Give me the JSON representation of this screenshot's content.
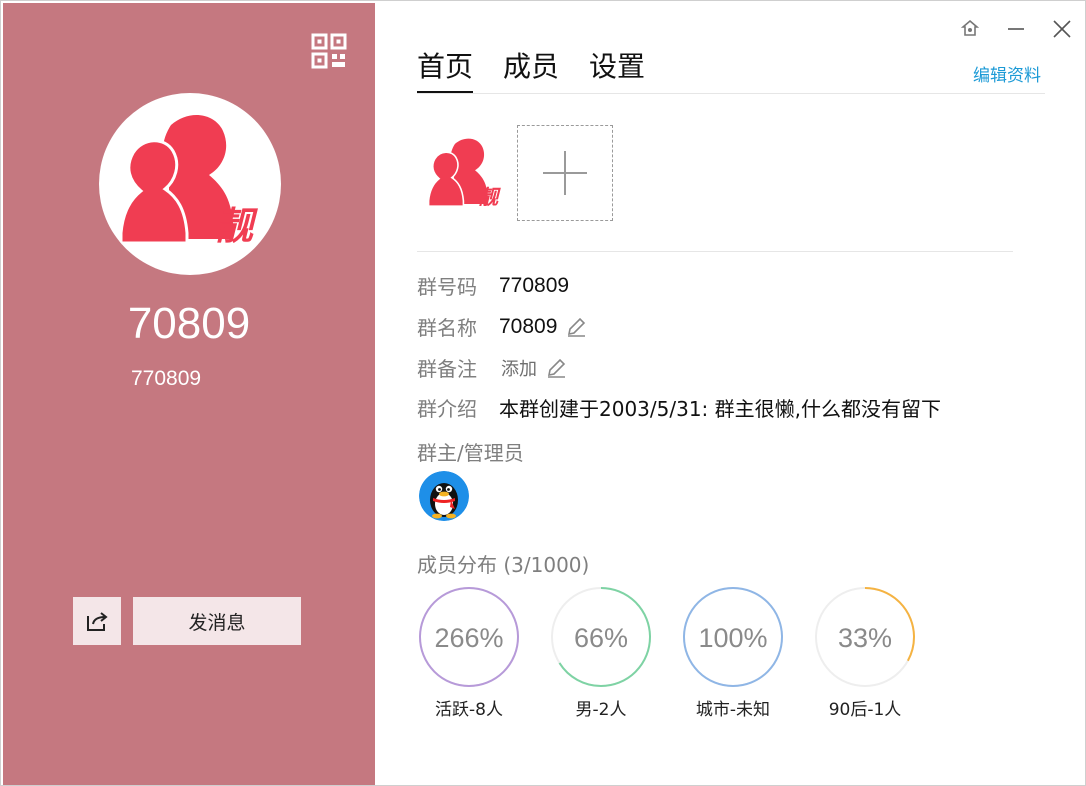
{
  "colors": {
    "left_panel_bg": "#c57880",
    "brand_red": "#f03d52",
    "link": "#1c9ad6"
  },
  "profile": {
    "name": "70809",
    "id": "770809",
    "avatar_text": "靓",
    "send_message": "发消息"
  },
  "tabs": [
    {
      "label": "首页",
      "active": true
    },
    {
      "label": "成员",
      "active": false
    },
    {
      "label": "设置",
      "active": false
    }
  ],
  "edit_profile": "编辑资料",
  "info": {
    "number_label": "群号码",
    "number_value": "770809",
    "name_label": "群名称",
    "name_value": "70809",
    "note_label": "群备注",
    "note_value": "添加",
    "intro_label": "群介绍",
    "intro_value": "本群创建于2003/5/31:  群主很懒,什么都没有留下"
  },
  "admins_title": "群主/管理员",
  "distribution": {
    "title": "成员分布 (3/1000)",
    "items": [
      {
        "percent_text": "266%",
        "label": "活跃-8人",
        "color": "#b79ad9",
        "fraction": 1.0
      },
      {
        "percent_text": "66%",
        "label": "男-2人",
        "color": "#7ed3a4",
        "fraction": 0.66
      },
      {
        "percent_text": "100%",
        "label": "城市-未知",
        "color": "#8fb6e6",
        "fraction": 1.0
      },
      {
        "percent_text": "33%",
        "label": "90后-1人",
        "color": "#f5b342",
        "fraction": 0.33
      }
    ]
  }
}
